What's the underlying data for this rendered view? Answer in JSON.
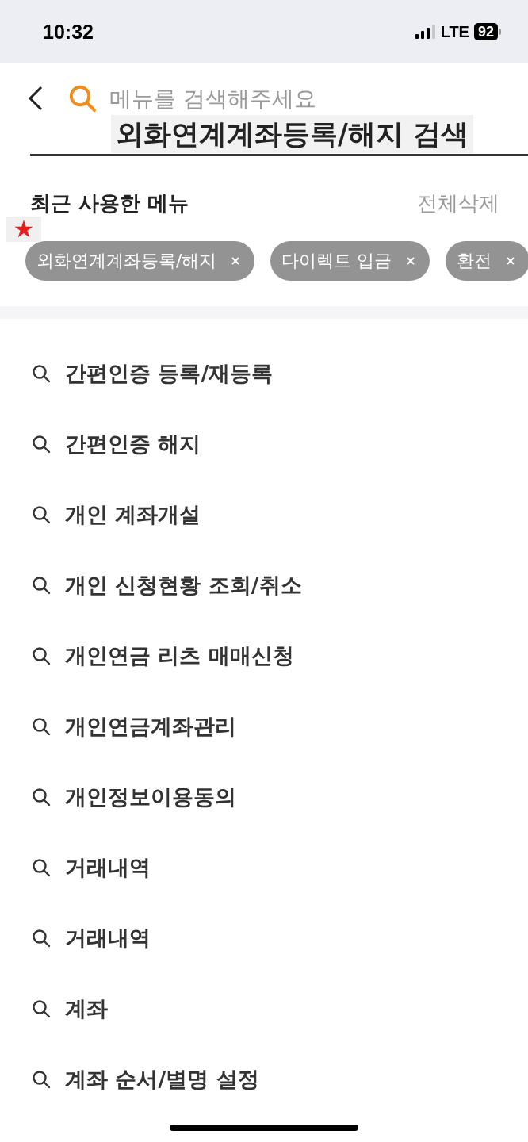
{
  "status_bar": {
    "time": "10:32",
    "network": "LTE",
    "battery": "92"
  },
  "search": {
    "placeholder": "메뉴를 검색해주세요"
  },
  "annotation": {
    "caption": "외화연계계좌등록/해지 검색",
    "marker": "★"
  },
  "recent": {
    "title": "최근 사용한 메뉴",
    "clear_all": "전체삭제",
    "chips": [
      {
        "label": "외화연계계좌등록/해지"
      },
      {
        "label": "다이렉트 입금"
      },
      {
        "label": "환전"
      }
    ]
  },
  "results": [
    {
      "label": "간편인증 등록/재등록"
    },
    {
      "label": "간편인증 해지"
    },
    {
      "label": "개인 계좌개설"
    },
    {
      "label": "개인 신청현황 조회/취소"
    },
    {
      "label": "개인연금 리츠 매매신청"
    },
    {
      "label": "개인연금계좌관리"
    },
    {
      "label": "개인정보이용동의"
    },
    {
      "label": "거래내역"
    },
    {
      "label": "거래내역"
    },
    {
      "label": "계좌"
    },
    {
      "label": "계좌 순서/별명 설정"
    }
  ]
}
